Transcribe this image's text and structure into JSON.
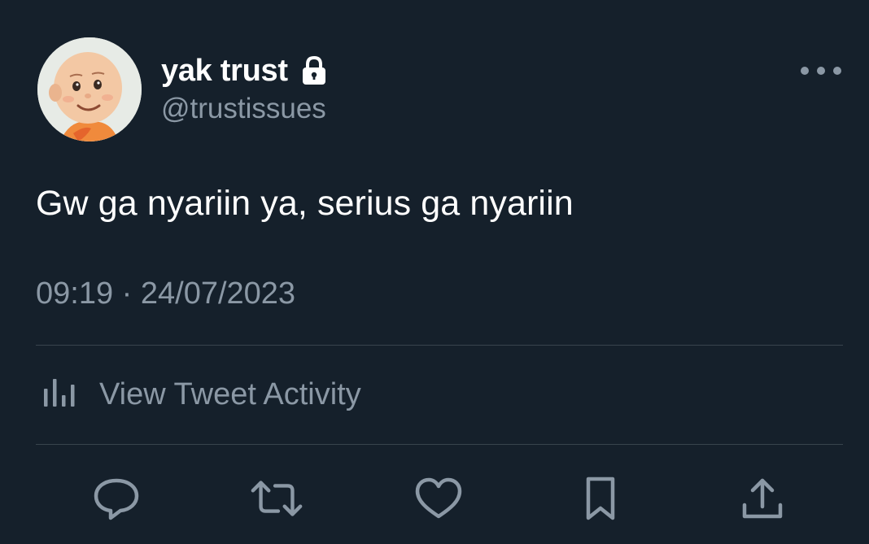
{
  "user": {
    "display_name": "yak trust",
    "handle": "@trustissues",
    "protected_icon": "lock-icon",
    "avatar": "cartoon-boy-avatar"
  },
  "tweet": {
    "text": "Gw ga nyariin ya, serius ga nyariin",
    "time": "09:19",
    "separator": "·",
    "date": "24/07/2023"
  },
  "activity": {
    "icon": "bar-chart-icon",
    "label": "View Tweet Activity"
  },
  "more_icon": "more-horizontal-icon",
  "actions": [
    {
      "name": "reply",
      "icon": "reply-icon"
    },
    {
      "name": "retweet",
      "icon": "retweet-icon"
    },
    {
      "name": "like",
      "icon": "heart-icon"
    },
    {
      "name": "bookmark",
      "icon": "bookmark-icon"
    },
    {
      "name": "share",
      "icon": "share-icon"
    }
  ],
  "colors": {
    "background": "#15202b",
    "primary_text": "#ffffff",
    "secondary_text": "#8b98a5",
    "divider": "#38444d"
  }
}
